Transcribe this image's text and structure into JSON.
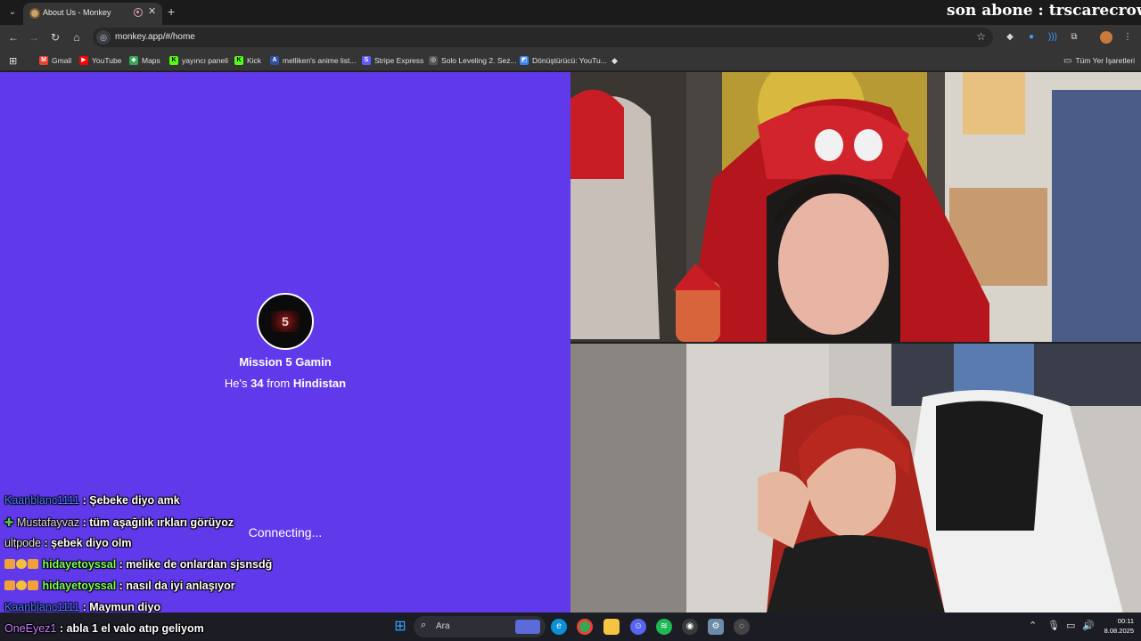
{
  "browser": {
    "tab": {
      "title": "About Us - Monkey"
    },
    "overlay_text": "son abone : trscarecrow",
    "address": {
      "url": "monkey.app/#/home"
    },
    "bookmarks": [
      {
        "label": "Gmail",
        "color": "#ea4335",
        "icon": "M"
      },
      {
        "label": "YouTube",
        "color": "#ff0000",
        "icon": "▶"
      },
      {
        "label": "Maps",
        "color": "#34a853",
        "icon": "◆"
      },
      {
        "label": "yayıncı paneli",
        "color": "#53fc18",
        "icon": "K"
      },
      {
        "label": "Kick",
        "color": "#53fc18",
        "icon": "K"
      },
      {
        "label": "melliken's anime list...",
        "color": "#2e51a2",
        "icon": "A"
      },
      {
        "label": "Stripe Express",
        "color": "#635bff",
        "icon": "S"
      },
      {
        "label": "Solo Leveling 2. Sez...",
        "color": "#888888",
        "icon": "◎"
      },
      {
        "label": "Dönüştürücü: YouTu...",
        "color": "#3b82f6",
        "icon": "◩"
      }
    ],
    "all_bookmarks_label": "Tüm Yer İşaretleri"
  },
  "profile": {
    "name": "Mission 5 Gamin",
    "age_prefix": "He's",
    "age": "34",
    "from_word": "from",
    "country": "Hindistan",
    "avatar_text": "5"
  },
  "status": {
    "connecting": "Connecting..."
  },
  "chat": [
    {
      "user": "Kaanblanc1111",
      "color": "#4a7fff",
      "message": ": Şebeke diyo amk",
      "badges": []
    },
    {
      "user": "Mustafayvaz",
      "color": "#d9d9d9",
      "message": ": tüm aşağılık ırkları görüyoz",
      "badges": [
        "#59c653"
      ]
    },
    {
      "user": "ultpode",
      "color": "#e6e6e6",
      "message": ": şebek diyo olm",
      "badges": []
    },
    {
      "user": "hidayetoyssal",
      "color": "#7aff5a",
      "message": ": melike de onlardan sjsnsdğ",
      "badges": [
        "#f2a03a",
        "#f2c03a",
        "#f2a03a"
      ]
    },
    {
      "user": "hidayetoyssal",
      "color": "#7aff5a",
      "message": ": nasıl da iyi anlaşıyor",
      "badges": [
        "#f2a03a",
        "#f2c03a",
        "#f2a03a"
      ]
    },
    {
      "user": "Kaanblanc1111",
      "color": "#4a7fff",
      "message": ": Maymun diyo",
      "badges": []
    },
    {
      "user": "OneEyez1",
      "color": "#c77dff",
      "message": ": abla 1 el valo atıp geliyom",
      "badges": []
    }
  ],
  "taskbar": {
    "search_placeholder": "Ara",
    "apps": [
      {
        "name": "start",
        "color": "#3aa0ff"
      },
      {
        "name": "widgets",
        "color": "#5b6bd9"
      },
      {
        "name": "edge",
        "color": "#0c8fd6"
      },
      {
        "name": "chrome",
        "color": "#34a853"
      },
      {
        "name": "file-explorer",
        "color": "#f5c542"
      },
      {
        "name": "discord",
        "color": "#5865f2"
      },
      {
        "name": "spotify",
        "color": "#1db954"
      },
      {
        "name": "app-dark",
        "color": "#3a3a3a"
      },
      {
        "name": "app-settings",
        "color": "#6a8ca8"
      },
      {
        "name": "app-obs",
        "color": "#444444"
      }
    ],
    "time": "00:11",
    "date": "8.08.2025"
  }
}
